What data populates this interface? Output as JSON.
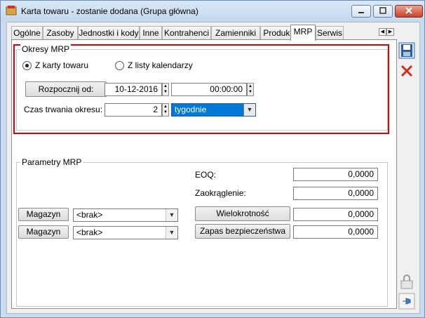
{
  "window": {
    "title": "Karta towaru - zostanie dodana (Grupa główna)"
  },
  "tabs": [
    {
      "label": "Ogólne"
    },
    {
      "label": "Zasoby"
    },
    {
      "label": "Jednostki i kody"
    },
    {
      "label": "Inne"
    },
    {
      "label": "Kontrahenci"
    },
    {
      "label": "Zamienniki"
    },
    {
      "label": "Produkcja"
    },
    {
      "label": "MRP",
      "active": true
    },
    {
      "label": "Serwis"
    }
  ],
  "okresy": {
    "legend": "Okresy MRP",
    "radio_karta": "Z karty towaru",
    "radio_listy": "Z listy kalendarzy",
    "selected": "Z karty towaru",
    "start_button": "Rozpocznij od:",
    "date": "10-12-2016",
    "time": "00:00:00",
    "duration_label": "Czas trwania okresu:",
    "duration_value": "2",
    "unit": "tygodnie"
  },
  "parametry": {
    "legend": "Parametry MRP",
    "eoq_label": "EOQ:",
    "eoq_value": "0,0000",
    "zaokraglenie_label": "Zaokrąglenie:",
    "zaokraglenie_value": "0,0000",
    "magazyn1_button": "Magazyn",
    "magazyn1_value": "<brak>",
    "magazyn2_button": "Magazyn",
    "magazyn2_value": "<brak>",
    "wielokrotnosc_button": "Wielokrotność",
    "wielokrotnosc_value": "0,0000",
    "zapas_button": "Zapas bezpieczeństwa",
    "zapas_value": "0,0000"
  },
  "colors": {
    "highlight_border": "#e00000",
    "selection": "#0078d7"
  }
}
